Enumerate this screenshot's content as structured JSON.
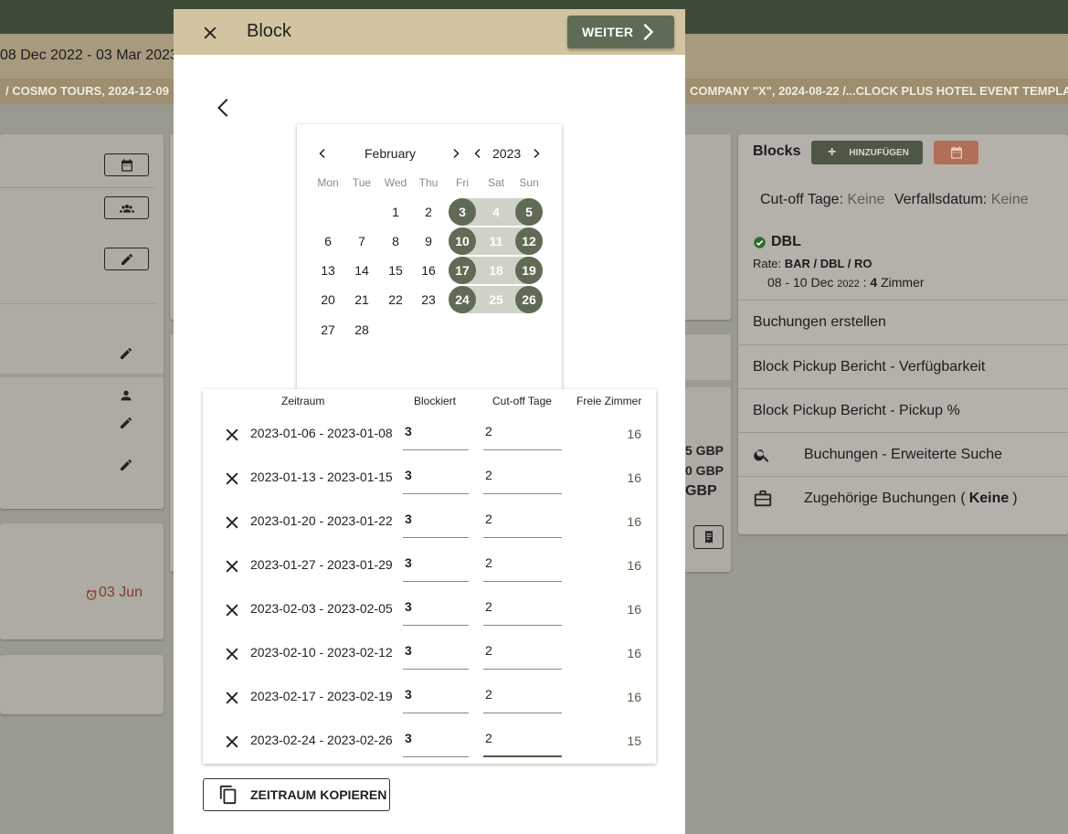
{
  "background": {
    "date_range": "08 Dec 2022 - 03 Mar 2023",
    "breadcrumbs": [
      "/  COSMO TOURS, 2024-12-09",
      "COMPANY \"X\", 2024-08-22  /...CLOCK PLUS HOTEL EVENT TEMPLATE"
    ],
    "left_date": "03 Jun",
    "prices": [
      "5 GBP",
      "0 GBP",
      "GBP"
    ]
  },
  "blocks_panel": {
    "title": "Blocks",
    "add_label": "HINZUFÜGEN",
    "cutoff_label": "Cut-off Tage:",
    "cutoff_value": "Keine",
    "expiry_label": "Verfallsdatum:",
    "expiry_value": "Keine",
    "block_name": "DBL",
    "rate_label": "Rate:",
    "rate_value": "BAR / DBL / RO",
    "block_dates": "08 - 10 Dec",
    "block_year": "2022",
    "block_sep": ":",
    "block_count": "4",
    "block_unit": "Zimmer",
    "menu": [
      {
        "label": "Buchungen erstellen",
        "icon": ""
      },
      {
        "label": "Block Pickup Bericht - Verfügbarkeit",
        "icon": ""
      },
      {
        "label": "Block Pickup Bericht - Pickup %",
        "icon": ""
      },
      {
        "label": "Buchungen - Erweiterte Suche",
        "icon": "search-icon"
      },
      {
        "label": "Zugehörige Buchungen",
        "icon": "briefcase-icon"
      }
    ],
    "related_open": "(",
    "related_value": "Keine",
    "related_close": ")"
  },
  "modal": {
    "title": "Block",
    "next_label": "WEITER",
    "copy_label": "ZEITRAUM KOPIEREN"
  },
  "calendar": {
    "month": "February",
    "year": "2023",
    "weekdays": [
      "Mon",
      "Tue",
      "Wed",
      "Thu",
      "Fri",
      "Sat",
      "Sun"
    ],
    "weeks": [
      [
        "",
        "",
        "1",
        "2",
        "3",
        "4",
        "5"
      ],
      [
        "6",
        "7",
        "8",
        "9",
        "10",
        "11",
        "12"
      ],
      [
        "13",
        "14",
        "15",
        "16",
        "17",
        "18",
        "19"
      ],
      [
        "20",
        "21",
        "22",
        "23",
        "24",
        "25",
        "26"
      ],
      [
        "27",
        "28",
        "",
        "",
        "",
        "",
        ""
      ]
    ],
    "selected_ranges": [
      [
        "3",
        "5"
      ],
      [
        "10",
        "12"
      ],
      [
        "17",
        "19"
      ],
      [
        "24",
        "26"
      ]
    ],
    "accent": "#5f6b55"
  },
  "periods": {
    "headers": {
      "range": "Zeitraum",
      "blocked": "Blockiert",
      "cutoff": "Cut-off Tage",
      "free": "Freie Zimmer"
    },
    "rows": [
      {
        "range": "2023-01-06 - 2023-01-08",
        "blocked": "3",
        "cutoff": "2",
        "free": "16"
      },
      {
        "range": "2023-01-13 - 2023-01-15",
        "blocked": "3",
        "cutoff": "2",
        "free": "16"
      },
      {
        "range": "2023-01-20 - 2023-01-22",
        "blocked": "3",
        "cutoff": "2",
        "free": "16"
      },
      {
        "range": "2023-01-27 - 2023-01-29",
        "blocked": "3",
        "cutoff": "2",
        "free": "16"
      },
      {
        "range": "2023-02-03 - 2023-02-05",
        "blocked": "3",
        "cutoff": "2",
        "free": "16"
      },
      {
        "range": "2023-02-10 - 2023-02-12",
        "blocked": "3",
        "cutoff": "2",
        "free": "16"
      },
      {
        "range": "2023-02-17 - 2023-02-19",
        "blocked": "3",
        "cutoff": "2",
        "free": "16"
      },
      {
        "range": "2023-02-24 - 2023-02-26",
        "blocked": "3",
        "cutoff": "2",
        "free": "15"
      }
    ]
  },
  "colors": {
    "primary": "#5f6b55",
    "danger": "#c0785e",
    "header": "#d3c4a1"
  }
}
